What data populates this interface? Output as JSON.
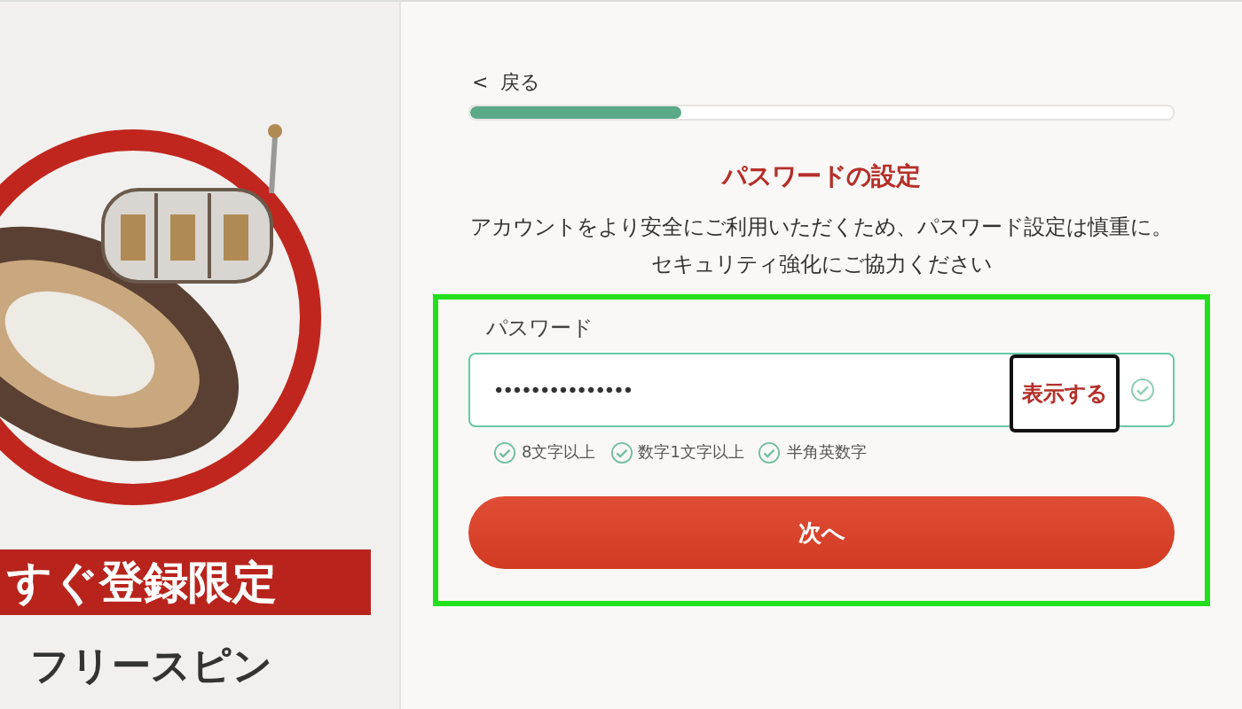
{
  "promo_banner": {
    "ribbon_text": "すぐ登録限定",
    "subtitle": "フリースピン"
  },
  "back_link": {
    "icon": "<",
    "label": "戻る"
  },
  "progress": {
    "level": 0.3
  },
  "title": "パスワードの設定",
  "description": "アカウントをより安全にご利用いただくため、パスワード設定は慎重に。セキュリティ強化にご協力ください",
  "password_field": {
    "label": "パスワード",
    "value": "•••••••••••••••",
    "show_button": "表示する"
  },
  "rules": [
    {
      "label": "8文字以上"
    },
    {
      "label": "数字1文字以上"
    },
    {
      "label": "半角英数字"
    }
  ],
  "next_button": "次へ"
}
